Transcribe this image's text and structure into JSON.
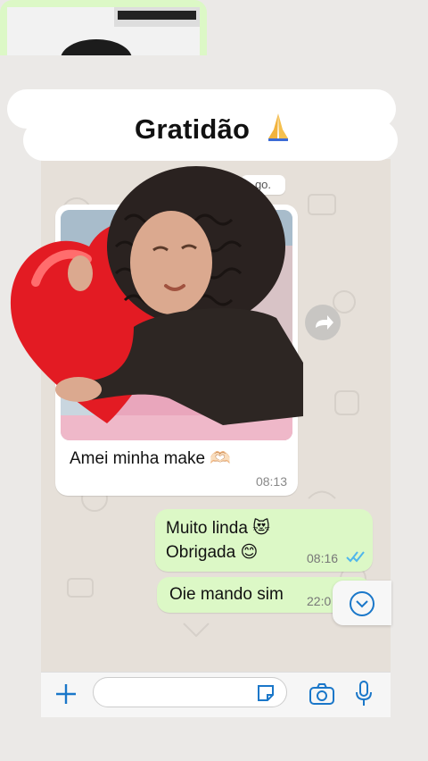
{
  "story": {
    "title": "Gratidão",
    "title_emoji_icon": "folded-hands-icon"
  },
  "chat": {
    "date_chip": "go.",
    "incoming": {
      "caption": "Amei minha make 🫶🏻",
      "time": "08:13"
    },
    "outgoing": [
      {
        "line1": "Muito linda 😻",
        "line2": "Obrigada 😊",
        "time": "08:16",
        "status": "read"
      },
      {
        "text": "Oie mando sim",
        "time": "22:0"
      }
    ]
  },
  "composer": {
    "placeholder": "",
    "plus_icon": "plus-icon",
    "sticker_icon": "sticker-icon",
    "camera_icon": "camera-icon",
    "mic_icon": "microphone-icon"
  },
  "colors": {
    "chat_background": "#e6e0d9",
    "outgoing_bubble": "#dcf8c6",
    "incoming_bubble": "#ffffff",
    "accent_blue": "#1a77c9",
    "read_ticks": "#4fb6ec"
  }
}
